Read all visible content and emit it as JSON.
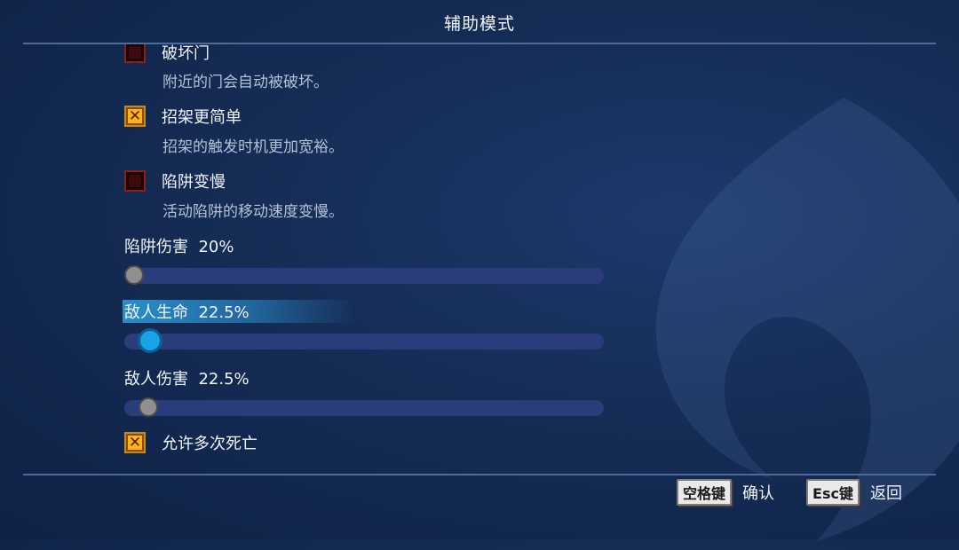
{
  "header": {
    "title": "辅助模式"
  },
  "options": [
    {
      "label": "破坏门",
      "description": "附近的门会自动被破坏。",
      "checked": false
    },
    {
      "label": "招架更简单",
      "description": "招架的触发时机更加宽裕。",
      "checked": true
    },
    {
      "label": "陷阱变慢",
      "description": "活动陷阱的移动速度变慢。",
      "checked": false
    }
  ],
  "sliders": [
    {
      "label": "陷阱伤害",
      "value_text": "20%",
      "value": 0.0,
      "selected": false
    },
    {
      "label": "敌人生命",
      "value_text": "22.5%",
      "value": 0.03,
      "selected": true
    },
    {
      "label": "敌人伤害",
      "value_text": "22.5%",
      "value": 0.03,
      "selected": false
    }
  ],
  "final_option": {
    "label": "允许多次死亡",
    "checked": true
  },
  "footer": {
    "confirm_key": "空格键",
    "confirm_label": "确认",
    "back_key": "Esc键",
    "back_label": "返回"
  },
  "colors": {
    "background": "#152c55",
    "checkbox_on": "#f7b41f",
    "checkbox_off": "#3b0a0a",
    "track": "#2a3d7a",
    "highlight": "#1aa2e6"
  }
}
